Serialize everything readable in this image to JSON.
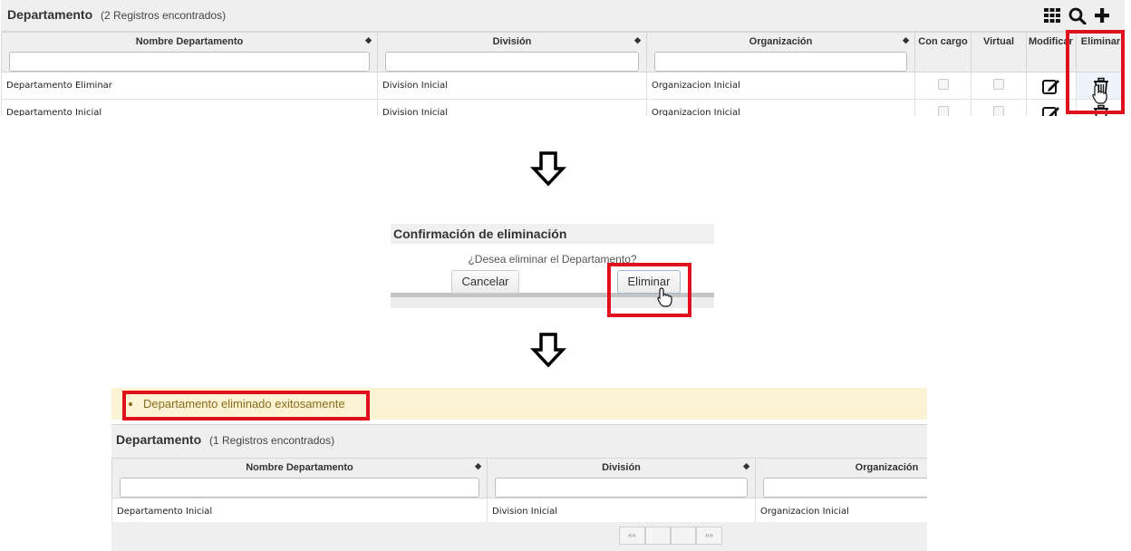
{
  "panel1": {
    "title": "Departamento",
    "count": "(2 Registros encontrados)",
    "toolbar": {
      "grid_icon": "grid-icon",
      "search_icon": "search-icon",
      "add_icon": "plus-icon"
    },
    "columns": [
      "Nombre Departamento",
      "División",
      "Organización",
      "Con cargo",
      "Virtual",
      "Modificar",
      "Eliminar"
    ],
    "rows": [
      {
        "nombre": "Departamento Eliminar",
        "division": "Division Inicial",
        "organizacion": "Organizacion Inicial"
      },
      {
        "nombre": "Departamento Inicial",
        "division": "Division Inicial",
        "organizacion": "Organizacion Inicial"
      }
    ]
  },
  "dialog": {
    "title": "Confirmación de eliminación",
    "message": "¿Desea eliminar el Departamento?",
    "cancel_label": "Cancelar",
    "confirm_label": "Eliminar"
  },
  "result": {
    "message": "Departamento eliminado exitosamente",
    "title": "Departamento",
    "count": "(1 Registros encontrados)",
    "columns": [
      "Nombre Departamento",
      "División",
      "Organización"
    ],
    "rows": [
      {
        "nombre": "Departamento Inicial",
        "division": "Division Inicial",
        "organizacion": "Organizacion Inicial"
      }
    ],
    "pager": {
      "first": "«",
      "prev": "«",
      "next": "»",
      "last": "»"
    }
  },
  "colors": {
    "highlight": "#e0101c",
    "message_bg": "#fcf3d4",
    "message_text": "#8a6d1a",
    "header_bg": "#efefef"
  }
}
